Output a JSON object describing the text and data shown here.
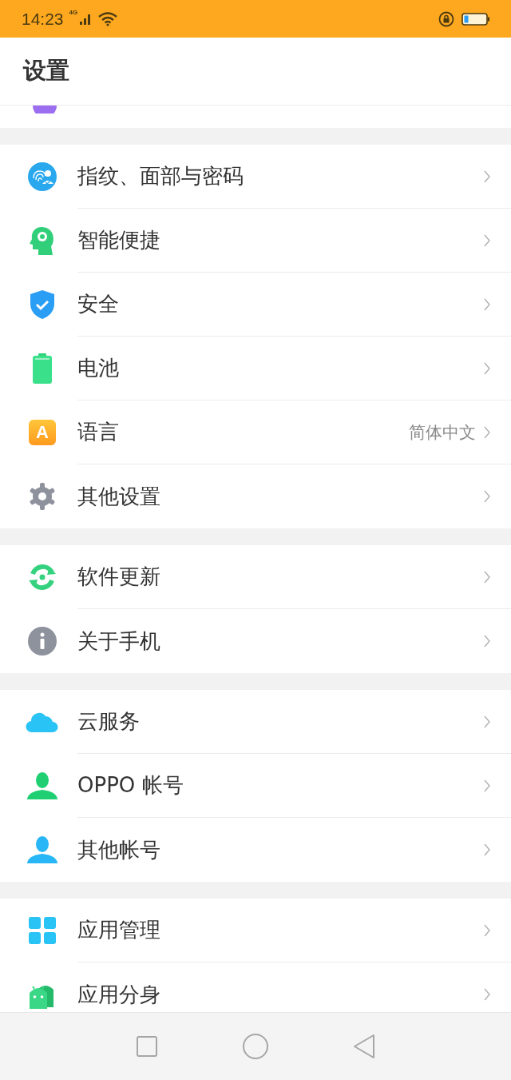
{
  "status_bar": {
    "time": "14:23",
    "network": "4G"
  },
  "header": {
    "title": "设置"
  },
  "groups": [
    {
      "items": [
        {
          "label": "指纹、面部与密码"
        },
        {
          "label": "智能便捷"
        },
        {
          "label": "安全"
        },
        {
          "label": "电池"
        },
        {
          "label": "语言",
          "value": "简体中文",
          "icon_letter": "A"
        },
        {
          "label": "其他设置"
        }
      ]
    },
    {
      "items": [
        {
          "label": "软件更新"
        },
        {
          "label": "关于手机"
        }
      ]
    },
    {
      "items": [
        {
          "label": "云服务"
        },
        {
          "label": "OPPO 帐号"
        },
        {
          "label": "其他帐号"
        }
      ]
    },
    {
      "items": [
        {
          "label": "应用管理"
        },
        {
          "label": "应用分身"
        }
      ]
    }
  ]
}
